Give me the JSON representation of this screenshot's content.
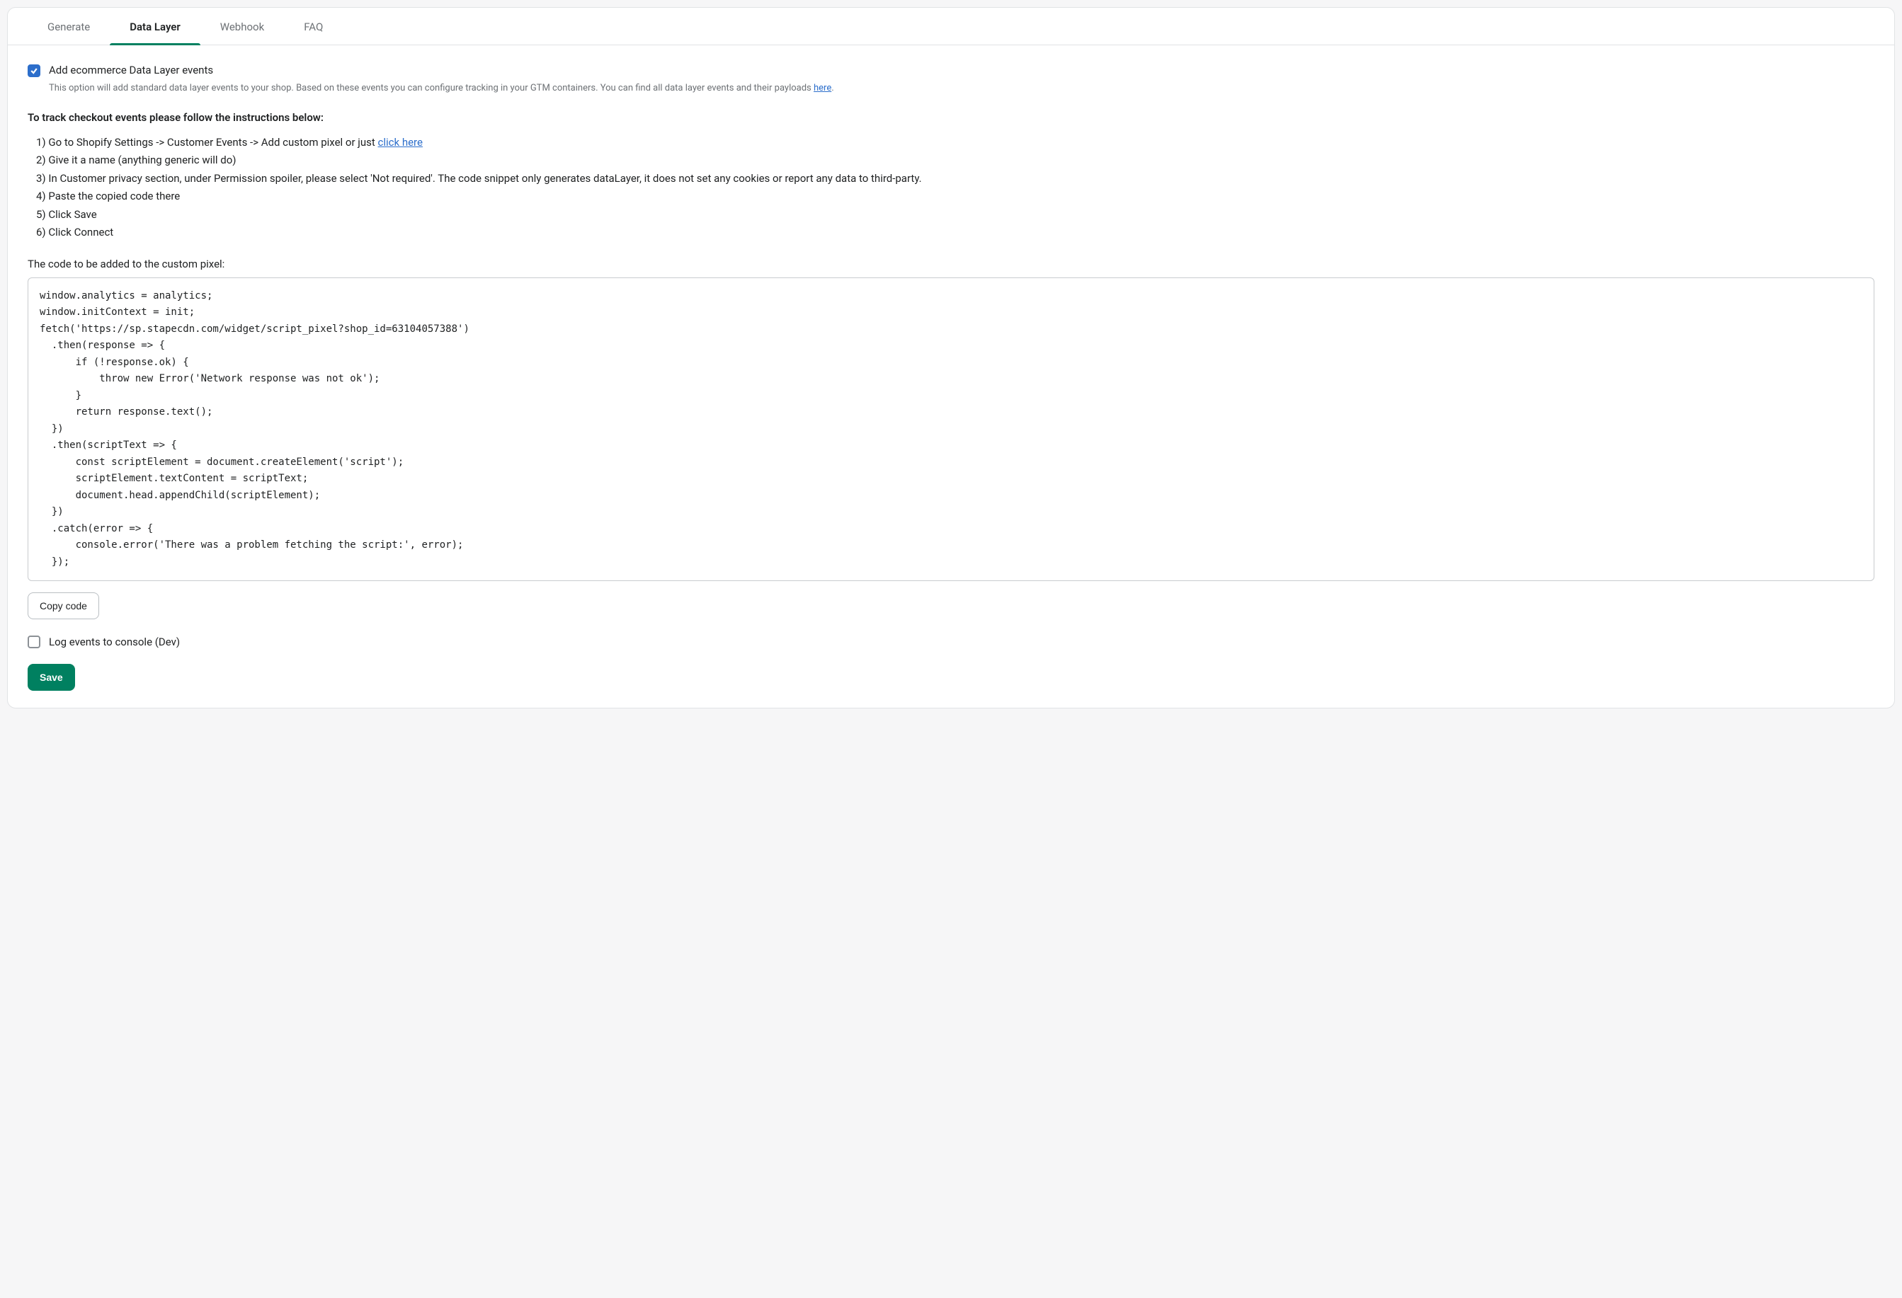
{
  "tabs": {
    "generate": "Generate",
    "data_layer": "Data Layer",
    "webhook": "Webhook",
    "faq": "FAQ"
  },
  "option": {
    "checkbox_label": "Add ecommerce Data Layer events",
    "help_prefix": "This option will add standard data layer events to your shop. Based on these events you can configure tracking in your GTM containers. You can find all data layer events and their payloads ",
    "help_link": "here",
    "help_suffix": "."
  },
  "instructions": {
    "heading": "To track checkout events please follow the instructions below:",
    "step1_prefix": "1) Go to Shopify Settings -> Customer Events -> Add custom pixel or just ",
    "step1_link": "click here",
    "step2": "2) Give it a name (anything generic will do)",
    "step3": "3) In Customer privacy section, under Permission spoiler, please select 'Not required'. The code snippet only generates dataLayer, it does not set any cookies or report any data to third-party.",
    "step4": "4) Paste the copied code there",
    "step5": "5) Click Save",
    "step6": "6) Click Connect"
  },
  "code": {
    "label": "The code to be added to the custom pixel:",
    "content": "window.analytics = analytics;\nwindow.initContext = init;\nfetch('https://sp.stapecdn.com/widget/script_pixel?shop_id=63104057388')\n  .then(response => {\n      if (!response.ok) {\n          throw new Error('Network response was not ok');\n      }\n      return response.text();\n  })\n  .then(scriptText => {\n      const scriptElement = document.createElement('script');\n      scriptElement.textContent = scriptText;\n      document.head.appendChild(scriptElement);\n  })\n  .catch(error => {\n      console.error('There was a problem fetching the script:', error);\n  });",
    "copy_button": "Copy code"
  },
  "log_events_label": "Log events to console (Dev)",
  "save_button": "Save"
}
